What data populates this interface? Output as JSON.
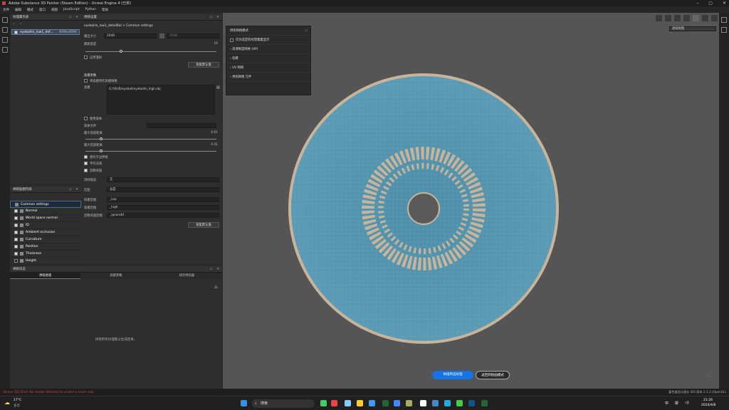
{
  "window": {
    "title": "Adobe Substance 3D Painter (Steam Edition) - Unreal Engine 4 (已烘)"
  },
  "menu": [
    "文件",
    "编辑",
    "模式",
    "窗口",
    "视图",
    "JavaScript",
    "Python",
    "帮助"
  ],
  "mesh_panel": {
    "title": "纹理集列表",
    "item_name": "eyeballin_low1_def...",
    "item_size": "4096x4096"
  },
  "bake_panel": {
    "title": "烘焙设置",
    "breadcrumb": "eyeballin_low1_detailBal > Common settings",
    "output_size_label": "输出大小",
    "output_size": "2048",
    "output_size_right": "2048",
    "dilation_label": "膨胀宽度",
    "dilation_value": "16",
    "apply_diffusion": "应用漫射",
    "reset_button": "恢复默认值",
    "hp_section": "高模参数",
    "use_low_as_high": "将低模用作高模网格",
    "hp_mesh_label": "高模",
    "hp_mesh_path": "G:/Sfs/B/eyeball/eyeballin_high.obj",
    "use_cage": "使用笼体",
    "cage_file_label": "笼体文件",
    "max_front_label": "最大前部距离",
    "max_front_value": "0.01",
    "max_rear_label": "最大后部距离",
    "max_rear_value": "0.01",
    "relative_bbox": "相对于边界框",
    "average_normals": "平均法线",
    "ignore_backface": "忽略背面",
    "antialias_label": "消除锯齿",
    "antialias_value": "无",
    "match_label": "匹配",
    "match_value": "总是",
    "low_suffix_label": "低模后缀",
    "low_suffix": "_low",
    "high_suffix_label": "高模后缀",
    "high_suffix": "_high",
    "ignore_suffix_label": "忽略背面后缀",
    "ignore_suffix": "_ignorebf",
    "reset_button2": "恢复默认值"
  },
  "maps_panel": {
    "title": "烘焙贴图列表",
    "items": [
      "Common settings",
      "Normal",
      "World space normal",
      "ID",
      "Ambient occlusion",
      "Curvature",
      "Position",
      "Thickness",
      "Height"
    ],
    "checked": [
      true,
      true,
      true,
      true,
      true,
      true,
      true,
      true,
      false
    ]
  },
  "log_panel": {
    "title": "烘焙日志",
    "tabs": [
      "烘焙进程",
      "高模参数",
      "排序烘焙器"
    ],
    "empty_text": "烘焙所有纹理集以生成结果。"
  },
  "viewport": {
    "overlay_title": "烘焙网格模式",
    "overlay_rows": [
      "仅为选定的纹理集集显示",
      "高清晰度网格 (HP)",
      "低模",
      "UV 网格",
      "烘焙网格 元件"
    ],
    "camera_select": "透视视图",
    "bake_button": "烘焙所选纹理",
    "exit_button": "返回到绘画模式"
  },
  "statusbar": {
    "error_text": "[Scene 3D] Shell: No shader detected to project a mesh map",
    "right_text": "着色器显示缓存 IDS 版本 2.1.3 (OpenGL)"
  },
  "taskbar": {
    "weather_temp": "17°C",
    "weather_desc": "多云",
    "search_placeholder": "搜索",
    "time": "21:26",
    "date": "2024/4/8",
    "lang": "中",
    "ime": "拼"
  },
  "colors": {
    "accent": "#1473e6",
    "surface": "#5a8fa8",
    "detail": "#c8b49a"
  }
}
